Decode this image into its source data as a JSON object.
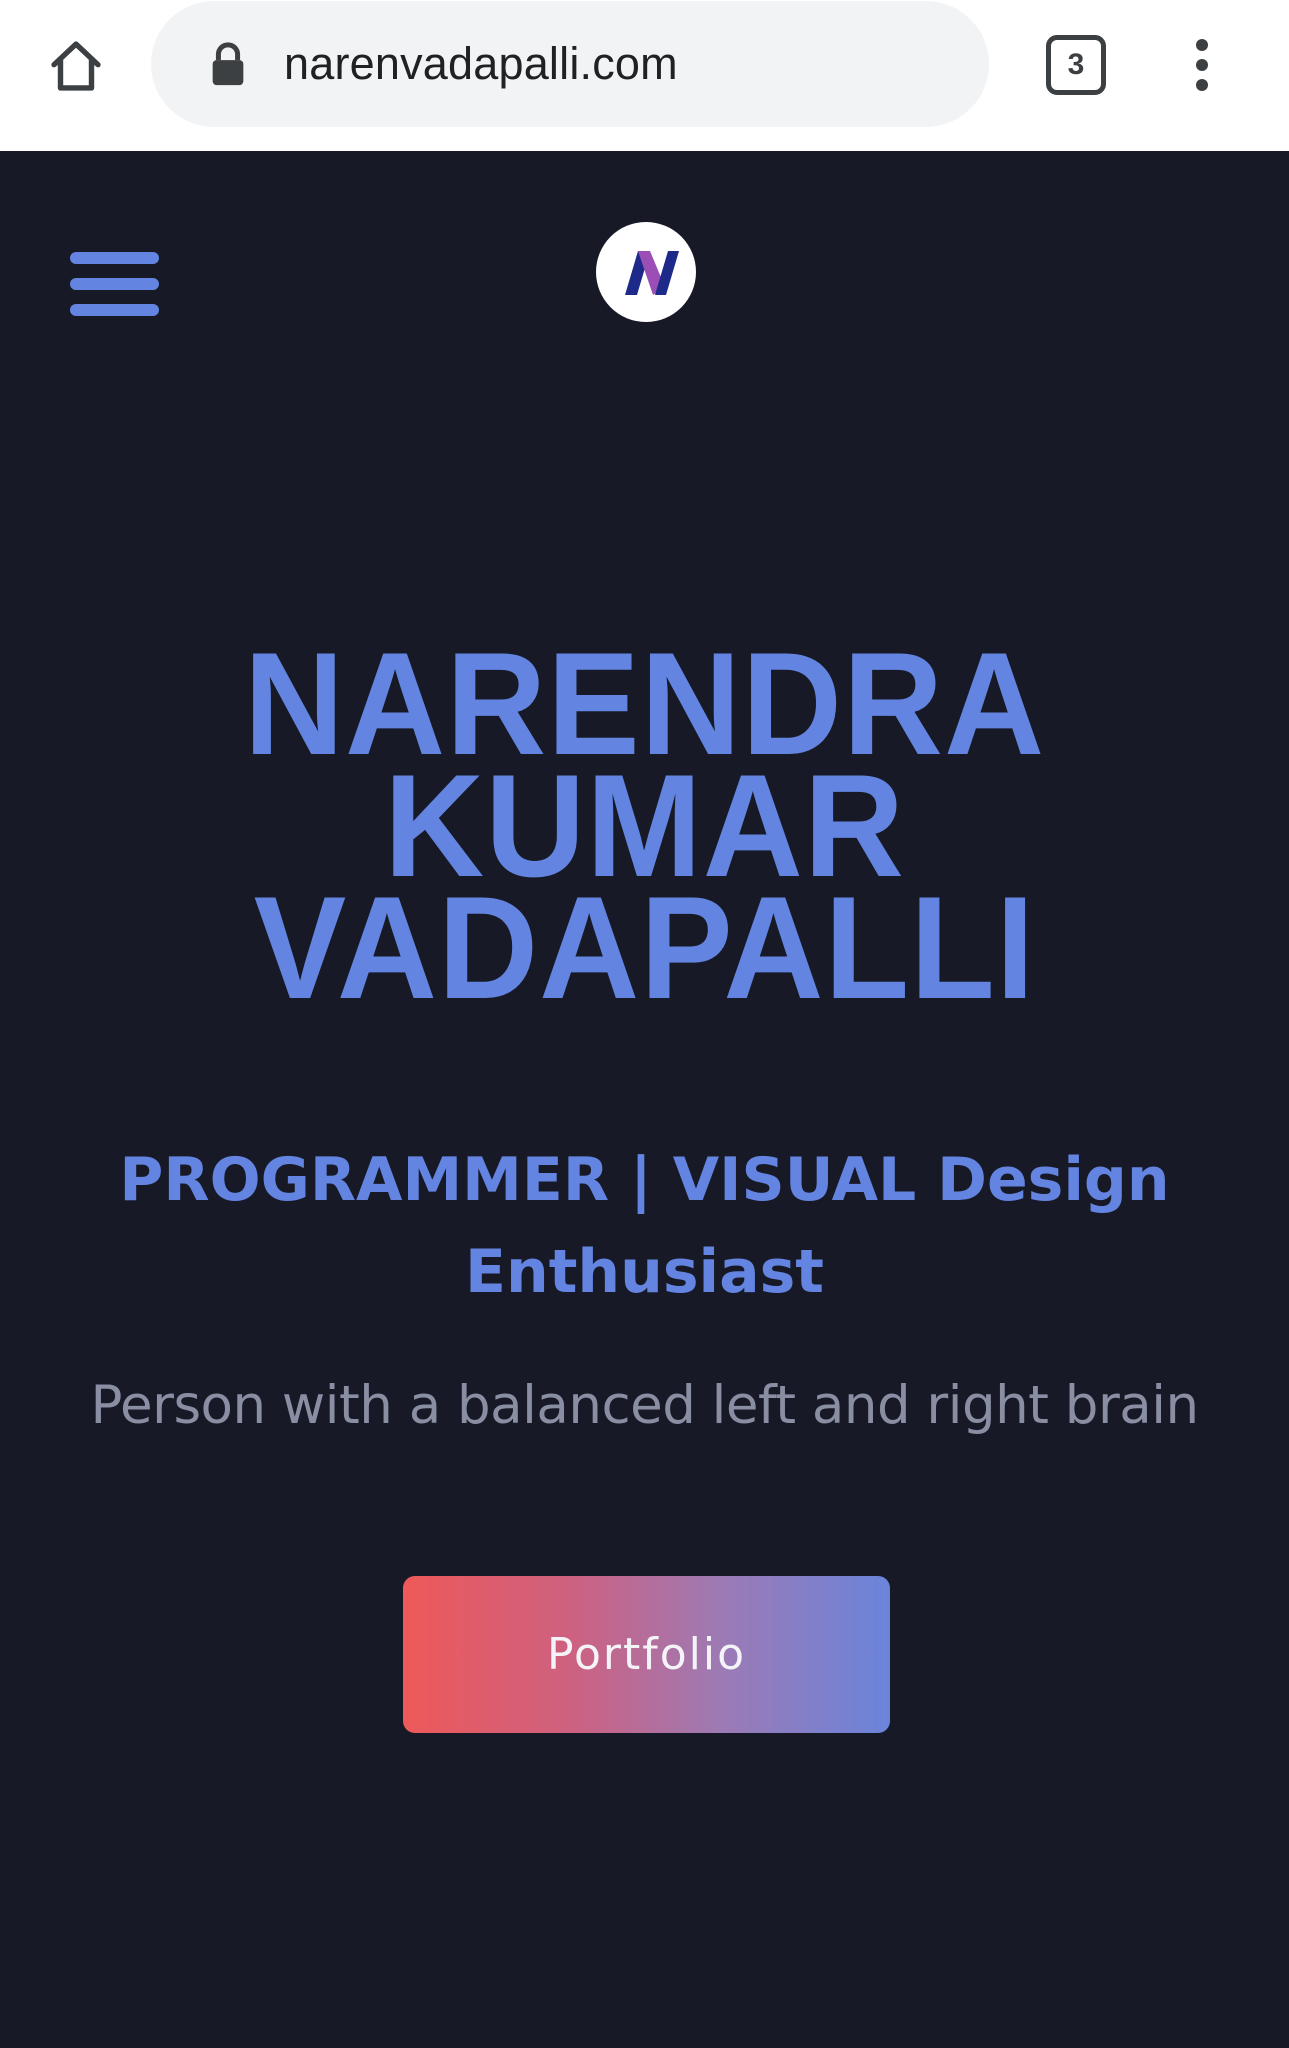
{
  "browser": {
    "home_icon": "home-icon",
    "lock_icon": "lock-icon",
    "url": "narenvadapalli.com",
    "tab_count": "3",
    "menu_icon": "more-vert-icon"
  },
  "header": {
    "menu_icon": "hamburger-menu-icon",
    "logo": "N",
    "logo_colors": {
      "outer": "#ffffff",
      "primary": "#1e2a8a",
      "accent": "#9b4fb6"
    }
  },
  "hero": {
    "name_lines": [
      "NARENDRA",
      "KUMAR",
      "VADAPALLI"
    ],
    "tagline": "PROGRAMMER | VISUAL Design Enthusiast",
    "subtitle": "Person with a balanced left and right brain",
    "cta_label": "Portfolio"
  },
  "theme": {
    "background": "#171a26",
    "accent": "#6384e0",
    "muted_text": "#8a8ea3",
    "button_gradient": [
      "#ee5959",
      "#6a84db"
    ]
  }
}
